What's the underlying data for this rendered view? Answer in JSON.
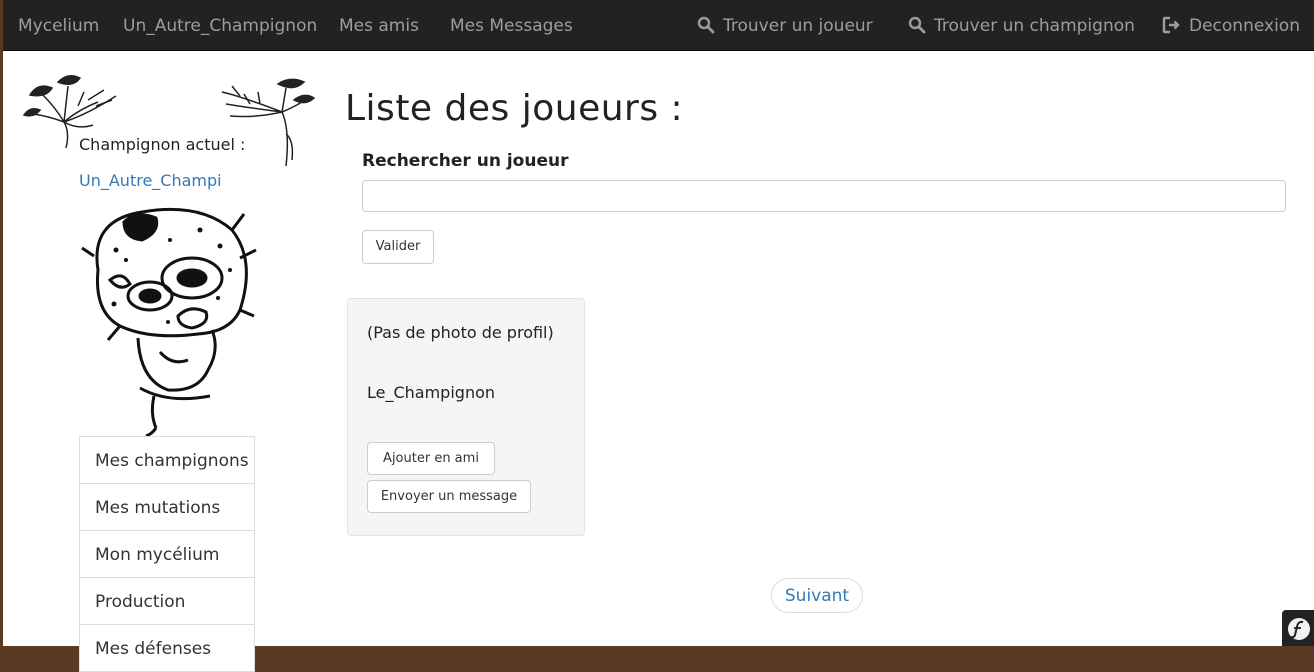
{
  "navbar": {
    "brand": "Mycelium",
    "items": [
      "Un_Autre_Champignon",
      "Mes amis",
      "Mes Messages"
    ],
    "right_items": [
      {
        "label": "Trouver un joueur",
        "icon": "search-icon"
      },
      {
        "label": "Trouver un champignon",
        "icon": "search-icon"
      },
      {
        "label": "Deconnexion",
        "icon": "logout-icon"
      }
    ]
  },
  "sidebar": {
    "current_label": "Champignon actuel :",
    "current_mushroom": "Un_Autre_Champi",
    "menu": [
      "Mes champignons",
      "Mes mutations",
      "Mon mycélium",
      "Production",
      "Mes défenses"
    ]
  },
  "main": {
    "title": "Liste des joueurs :",
    "search_label": "Rechercher un joueur",
    "search_value": "",
    "submit_label": "Valider",
    "players": [
      {
        "photo_text": "(Pas de photo de profil)",
        "name": "Le_Champignon",
        "add_friend_label": "Ajouter en ami",
        "message_label": "Envoyer un message"
      }
    ],
    "next_label": "Suivant"
  },
  "colors": {
    "navbar_bg": "#222222",
    "navbar_text": "#9d9d9d",
    "link": "#337ab7",
    "card_bg": "#f5f5f5"
  }
}
